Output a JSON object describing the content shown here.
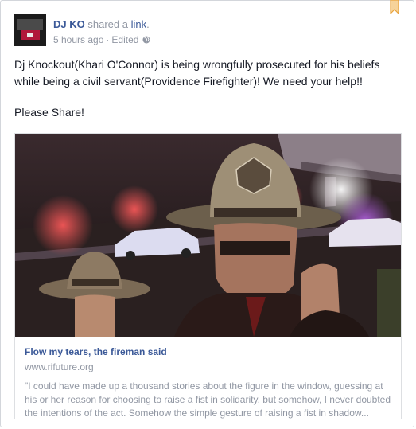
{
  "post": {
    "author": "DJ KO",
    "action_prefix": "shared a",
    "action_link": "link",
    "action_suffix": ".",
    "timestamp": "5 hours ago",
    "separator": "·",
    "edited": "Edited",
    "privacy_icon": "globe-icon",
    "message": "Dj Knockout(Khari O'Connor) is being wrongfully prosecuted for his beliefs while being a civil servant(Providence Firefighter)! We need your help!!",
    "message2": "Please Share!"
  },
  "attachment": {
    "title": "Flow my tears, the fireman said",
    "domain": "www.rifuture.org",
    "description": "\"I could have made up a thousand stories about the figure in the window, guessing at his or her reason for choosing to raise a fist in solidarity, but somehow, I never doubted the intentions of the act. Somehow the simple gesture of raising a fist in shadow..."
  },
  "colors": {
    "link_blue": "#3b5998",
    "meta_gray": "#9197a3",
    "bookmark_orange": "#f0a030"
  }
}
